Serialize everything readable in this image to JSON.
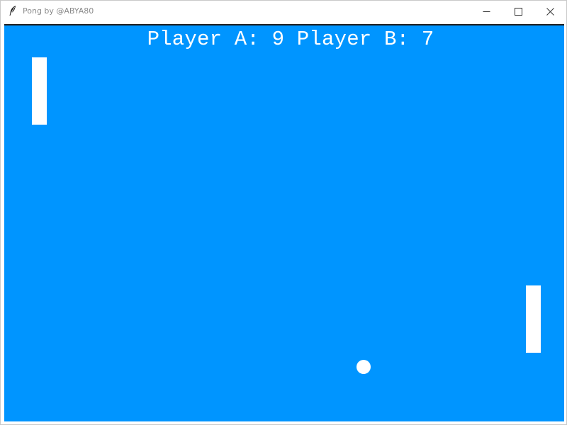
{
  "window": {
    "title": "Pong by @ABYA80",
    "icon": "feather-icon"
  },
  "controls": {
    "minimize_icon": "minimize-icon",
    "maximize_icon": "maximize-icon",
    "close_icon": "close-icon"
  },
  "game": {
    "background_color": "#0095ff",
    "scoreboard_text": "Player A: 9 Player B: 7",
    "player_a_label": "Player A",
    "player_a_score": 9,
    "player_b_label": "Player B",
    "player_b_score": 7,
    "paddle_color": "#ffffff",
    "ball_color": "#ffffff"
  }
}
